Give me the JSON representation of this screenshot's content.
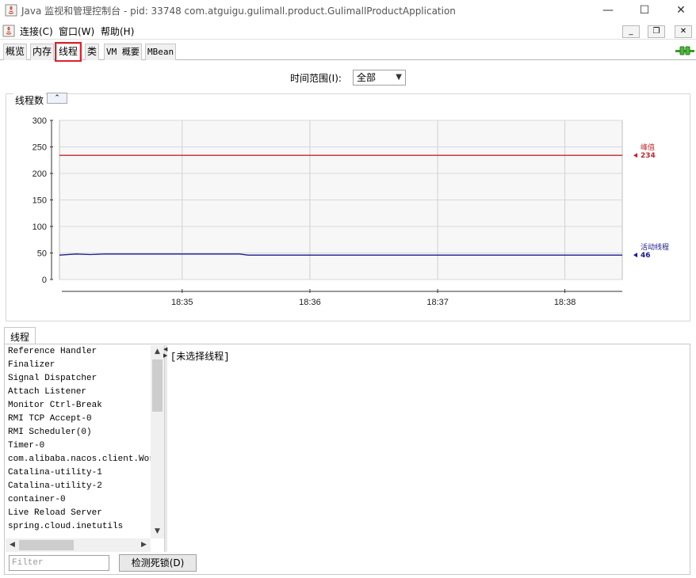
{
  "window": {
    "title": "Java 监视和管理控制台 - pid: 33748 com.atguigu.gulimall.product.GulimallProductApplication",
    "minimize": "—",
    "maximize": "☐",
    "close": "✕"
  },
  "menu": {
    "items": [
      "连接(C)",
      "窗口(W)",
      "帮助(H)"
    ],
    "mdi_minimize": "_",
    "mdi_restore": "❐",
    "mdi_close": "✕"
  },
  "tabs": [
    "概览",
    "内存",
    "线程",
    "类",
    "VM 概要",
    "MBean"
  ],
  "active_tab": "线程",
  "time_range": {
    "label": "时间范围(I):",
    "value": "全部"
  },
  "chart_section": {
    "title": "线程数",
    "collapse_glyph": "⌃"
  },
  "chart_data": {
    "type": "line",
    "title": "",
    "xlabel": "",
    "ylabel": "",
    "ylim": [
      0,
      300
    ],
    "yticks": [
      0,
      50,
      100,
      150,
      200,
      250,
      300
    ],
    "xticks": [
      "18:35",
      "18:36",
      "18:37",
      "18:38"
    ],
    "grid": true,
    "series": [
      {
        "name": "峰值",
        "color": "#c0282e",
        "last_value": "234",
        "points": [
          [
            0,
            234
          ],
          [
            1,
            234
          ]
        ]
      },
      {
        "name": "活动线程",
        "color": "#1a1a8c",
        "last_value": "46",
        "points": [
          [
            0,
            46
          ],
          [
            0.03,
            48
          ],
          [
            0.055,
            47
          ],
          [
            0.08,
            48
          ],
          [
            0.32,
            48
          ],
          [
            0.335,
            46
          ],
          [
            1,
            46
          ]
        ]
      }
    ]
  },
  "threads_tab": "线程",
  "threads": [
    "Reference Handler",
    "Finalizer",
    "Signal Dispatcher",
    "Attach Listener",
    "Monitor Ctrl-Break",
    "RMI TCP Accept-0",
    "RMI Scheduler(0)",
    "Timer-0",
    "com.alibaba.nacos.client.Worke",
    "Catalina-utility-1",
    "Catalina-utility-2",
    "container-0",
    "Live Reload Server",
    "spring.cloud.inetutils"
  ],
  "detail_text": "[未选择线程]",
  "filter_placeholder": "Filter",
  "deadlock_button": "检测死锁(D)",
  "scroll": {
    "up": "▲",
    "down": "▼",
    "left": "◀",
    "right": "▶"
  },
  "split_arrows": {
    "left": "◀",
    "right": "▶"
  }
}
